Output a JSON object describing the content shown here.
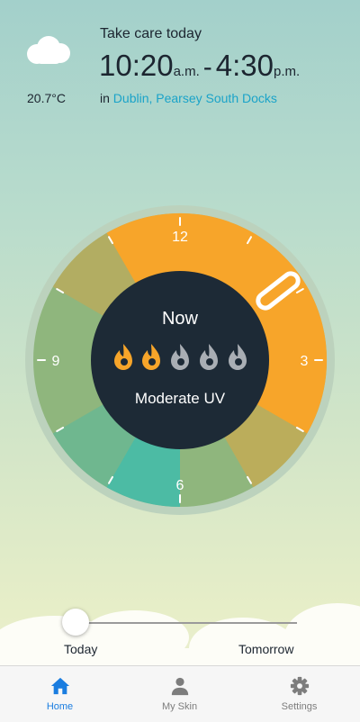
{
  "header": {
    "title": "Take care today",
    "start_time": "10:20",
    "start_suffix": "a.m.",
    "separator": "-",
    "end_time": "4:30",
    "end_suffix": "p.m.",
    "location_prefix": "in",
    "location": "Dublin, Pearsey South Docks"
  },
  "weather": {
    "icon": "cloud-icon",
    "temperature": "20.7°C"
  },
  "dial": {
    "hour_labels": [
      "12",
      "3",
      "6",
      "9"
    ],
    "now_label": "Now",
    "uv_level_filled": 2,
    "uv_level_total": 5,
    "uv_label": "Moderate UV",
    "colors": {
      "high": "#f7a52a",
      "moderate": "#88b27a",
      "low": "#4cbba4",
      "center": "#1d2a36",
      "flame_on": "#f7a52a",
      "flame_off": "#a9aeb4"
    }
  },
  "slider": {
    "left_label": "Today",
    "right_label": "Tomorrow",
    "position": 0
  },
  "tabs": [
    {
      "label": "Home",
      "icon": "home-icon",
      "active": true
    },
    {
      "label": "My Skin",
      "icon": "person-icon",
      "active": false
    },
    {
      "label": "Settings",
      "icon": "gear-icon",
      "active": false
    }
  ],
  "colors": {
    "accent": "#1a7de0",
    "inactive": "#7d7d7d",
    "link": "#1aa3c9"
  }
}
